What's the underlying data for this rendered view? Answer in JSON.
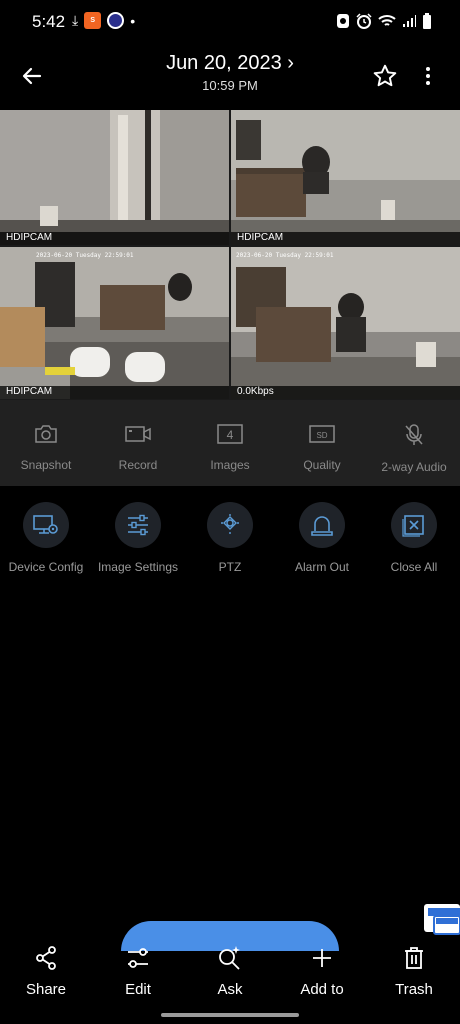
{
  "status_bar": {
    "time": "5:42",
    "icons": [
      "download-icon",
      "app-icon-orange",
      "app-icon-crypto",
      "dot",
      "nfc-icon",
      "alarm-icon",
      "wifi-icon",
      "signal-icon",
      "battery-icon"
    ]
  },
  "header": {
    "date": "Jun 20, 2023 ›",
    "time": "10:59 PM"
  },
  "cameras": [
    {
      "label": "HDIPCAM"
    },
    {
      "label": "HDIPCAM"
    },
    {
      "label": "HDIPCAM"
    },
    {
      "label": "0.0Kbps"
    }
  ],
  "toolbar": {
    "items": [
      {
        "label": "Snapshot",
        "icon": "camera-icon"
      },
      {
        "label": "Record",
        "icon": "video-icon"
      },
      {
        "label": "Images",
        "icon": "grid-count-icon",
        "badge": "4"
      },
      {
        "label": "Quality",
        "icon": "sd-icon",
        "badge": "SD"
      },
      {
        "label": "2-way Audio",
        "icon": "mic-icon"
      }
    ]
  },
  "functions": {
    "items": [
      {
        "label": "Device Config",
        "icon": "device-config-icon"
      },
      {
        "label": "Image Settings",
        "icon": "sliders-icon"
      },
      {
        "label": "PTZ",
        "icon": "ptz-icon"
      },
      {
        "label": "Alarm Out",
        "icon": "alarm-light-icon"
      },
      {
        "label": "Close All",
        "icon": "close-all-icon"
      }
    ]
  },
  "bottom_nav": {
    "items": [
      {
        "label": "Share",
        "icon": "share-icon"
      },
      {
        "label": "Edit",
        "icon": "edit-icon"
      },
      {
        "label": "Ask",
        "icon": "ask-icon"
      },
      {
        "label": "Add to",
        "icon": "plus-icon"
      },
      {
        "label": "Trash",
        "icon": "trash-icon"
      }
    ]
  },
  "colors": {
    "background": "#000000",
    "toolbar": "#212121",
    "accent": "#4a8fe7",
    "func_icon": "#5b9bd5"
  }
}
